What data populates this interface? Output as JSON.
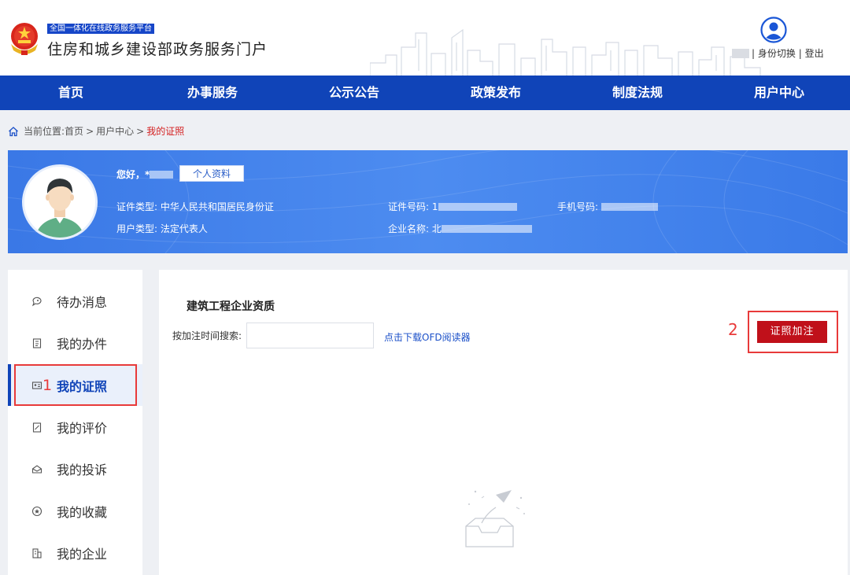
{
  "header": {
    "platform_tag": "全国一体化在线政务服务平台",
    "site_title": "住房和城乡建设部政务服务门户",
    "switch_identity": "身份切换",
    "separator": "|",
    "logout": "登出"
  },
  "nav": {
    "items": [
      "首页",
      "办事服务",
      "公示公告",
      "政策发布",
      "制度法规",
      "用户中心"
    ]
  },
  "breadcrumb": {
    "prefix": "当前位置:",
    "home": "首页",
    "sep": ">",
    "user_center": "用户中心",
    "current": "我的证照"
  },
  "profile": {
    "greeting": "您好，*",
    "profile_button": "个人资料",
    "id_type_label": "证件类型:",
    "id_type_value": "中华人民共和国居民身份证",
    "user_type_label": "用户类型:",
    "user_type_value": "法定代表人",
    "id_number_label": "证件号码:",
    "id_number_value": "1",
    "company_label": "企业名称:",
    "company_value": "北",
    "phone_label": "手机号码:"
  },
  "sidebar": {
    "items": [
      "待办消息",
      "我的办件",
      "我的证照",
      "我的评价",
      "我的投诉",
      "我的收藏",
      "我的企业"
    ],
    "active_index": 2
  },
  "main": {
    "section_title": "建筑工程企业资质",
    "search_label": "按加注时间搜索:",
    "search_value": "",
    "ofd_link": "点击下载OFD阅读器",
    "cert_button": "证照加注"
  },
  "annotations": {
    "step1": "1",
    "step2": "2"
  },
  "colors": {
    "nav_bg": "#1044b8",
    "banner_bg": "#4d8cf0",
    "cert_button_bg": "#c0101a",
    "annotation_red": "#e83a3a",
    "breadcrumb_current": "#d42020"
  }
}
